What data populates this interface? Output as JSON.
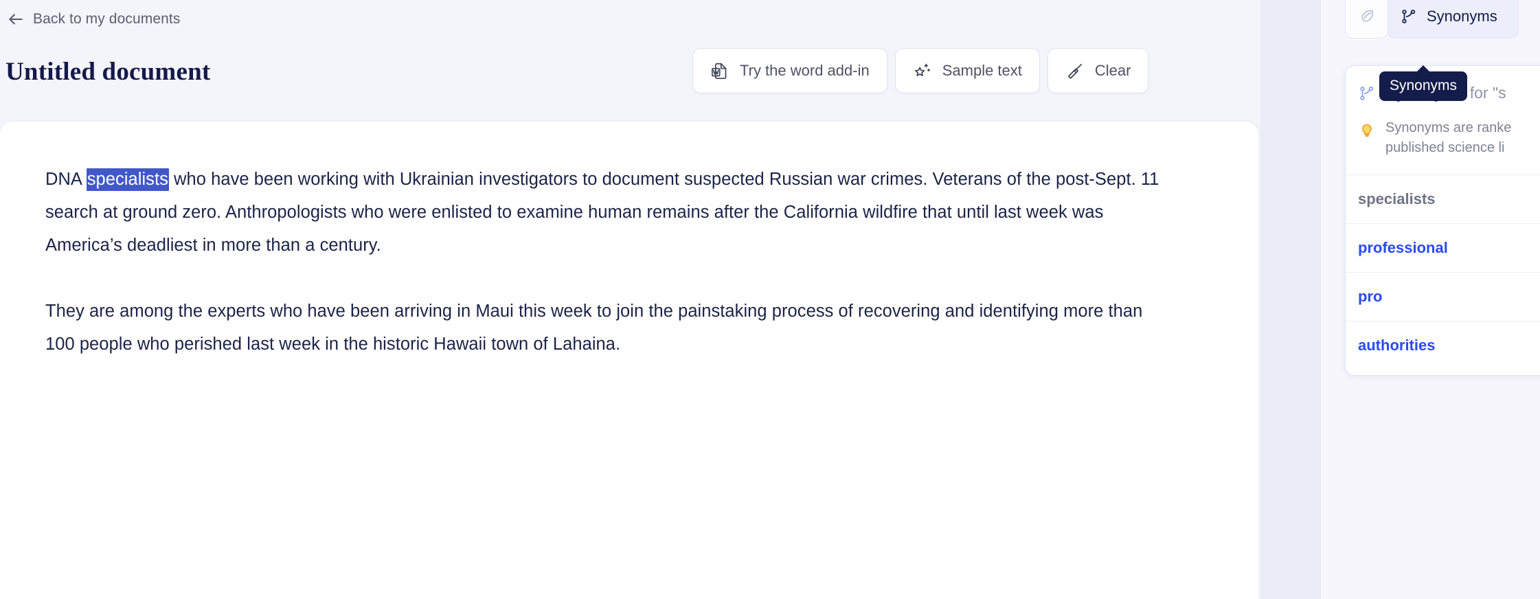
{
  "nav": {
    "back_label": "Back to my documents",
    "back_icon": "arrow-left-icon"
  },
  "header": {
    "title": "Untitled document"
  },
  "toolbar": {
    "buttons": [
      {
        "label": "Try the word add-in",
        "icon": "word-document-icon"
      },
      {
        "label": "Sample text",
        "icon": "sparkle-star-icon"
      },
      {
        "label": "Clear",
        "icon": "broom-icon"
      }
    ]
  },
  "document": {
    "paragraphs": [
      {
        "before": "DNA ",
        "selected": "specialists",
        "after": " who have been working with Ukrainian investigators to document suspected Russian war crimes. Veterans of the post-Sept. 11 search at ground zero. Anthropologists who were enlisted to examine human remains after the California wildfire that until last week was America’s deadliest in more than a century."
      },
      {
        "text": "They are among the experts who have been arriving in Maui this week to join the painstaking process of recovering and identifying more than 100 people who perished last week in the historic Hawaii town of Lahaina."
      }
    ],
    "selection_color": "#4258c9"
  },
  "right_panel": {
    "tabs": [
      {
        "label": "",
        "icon": "quill-pen-icon",
        "active": false
      },
      {
        "label": "Synonyms",
        "icon": "branch-icon",
        "active": true
      }
    ],
    "tooltip": "Synonyms",
    "panel": {
      "heading_strong": "Synonyms",
      "heading_rest": " for \"s",
      "heading_icon": "branch-icon",
      "tip_icon": "lightbulb-icon",
      "tip_line1": "Synonyms are ranke",
      "tip_line2": "published science li",
      "items": [
        {
          "label": "specialists",
          "state": "current"
        },
        {
          "label": "professional",
          "state": "alt"
        },
        {
          "label": "pro",
          "state": "alt"
        },
        {
          "label": "authorities",
          "state": "alt"
        }
      ]
    }
  },
  "colors": {
    "accent_blue": "#2a4bf0",
    "heading_blue": "#2f49d6",
    "page_bg": "#f4f4fb",
    "tooltip_bg": "#141c4b"
  }
}
